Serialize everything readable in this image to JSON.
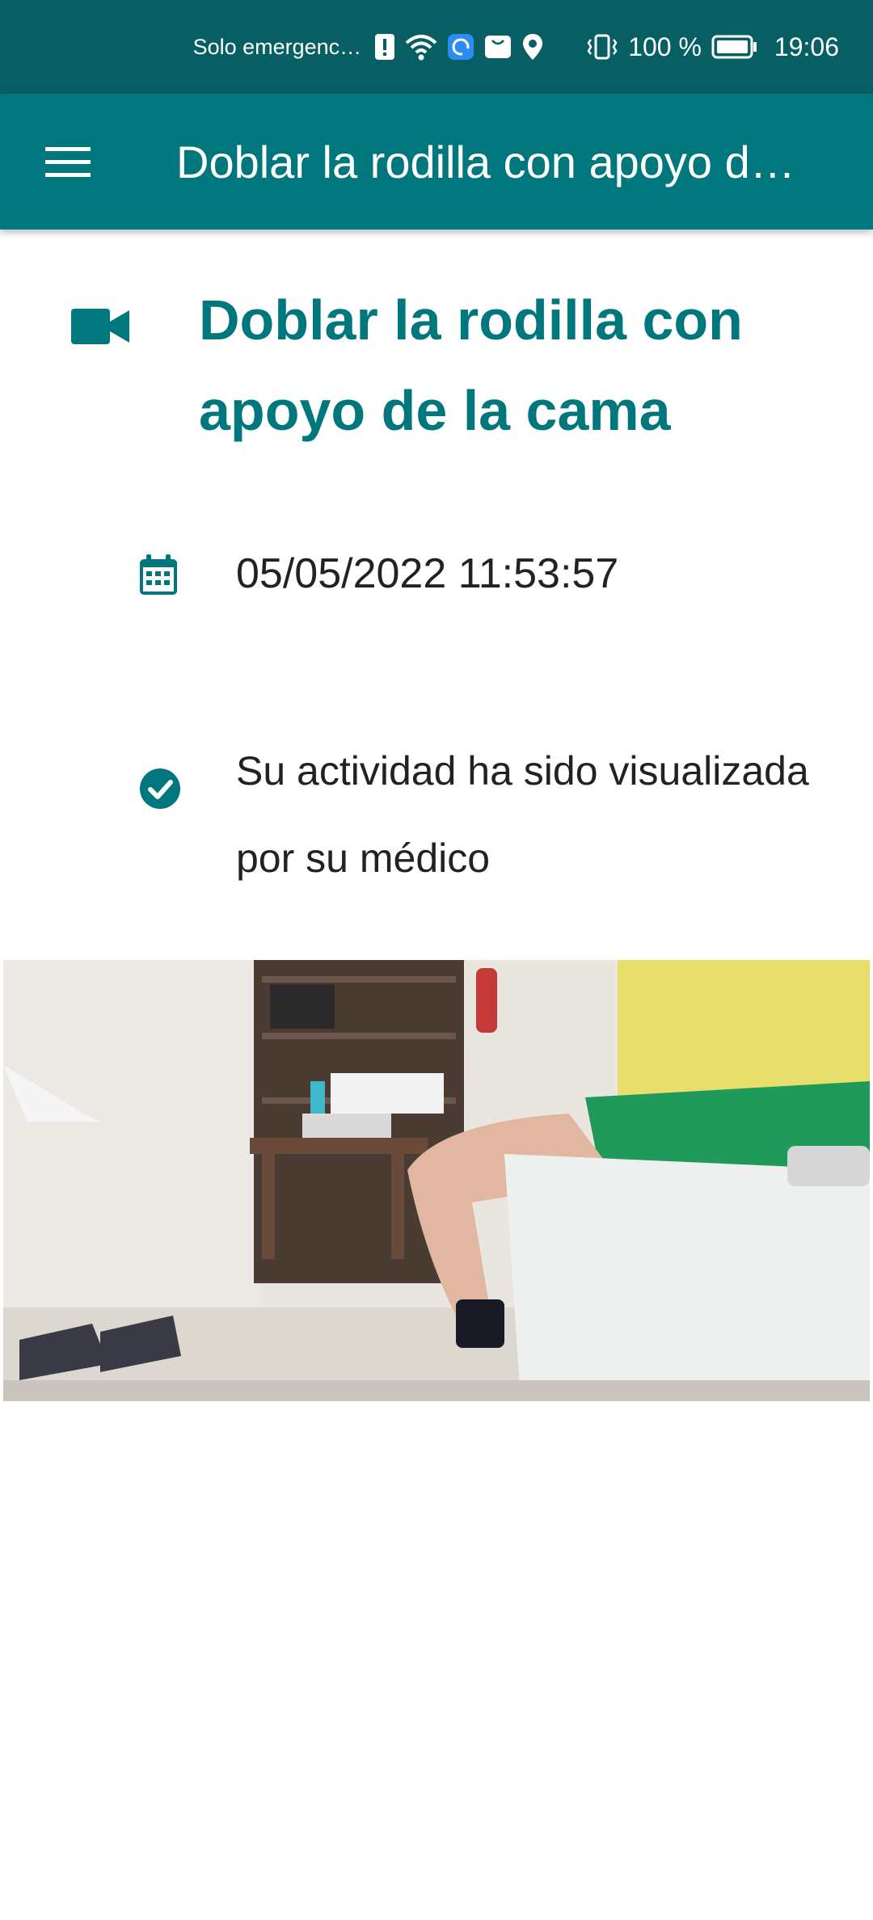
{
  "status_bar": {
    "carrier": "Solo emergenc…",
    "battery_percent": "100 %",
    "time": "19:06",
    "icons": [
      "alert-sim-icon",
      "wifi-icon",
      "assistant-icon",
      "huawei-store-icon",
      "location-icon",
      "vibrate-icon",
      "battery-icon"
    ]
  },
  "app_bar": {
    "menu_icon": "hamburger-menu-icon",
    "title": "Doblar la rodilla con apoyo de la cama"
  },
  "activity": {
    "type_icon": "video-camera-icon",
    "title": "Doblar la rodilla con apoyo de la cama",
    "date_icon": "calendar-icon",
    "datetime": "05/05/2022 11:53:57",
    "status_icon": "check-circle-icon",
    "status_text": "Su actividad ha sido visualizada por su médico"
  },
  "colors": {
    "status_bar_bg": "#075e63",
    "app_bar_bg": "#00777c",
    "accent": "#00777c",
    "text": "#222222"
  }
}
